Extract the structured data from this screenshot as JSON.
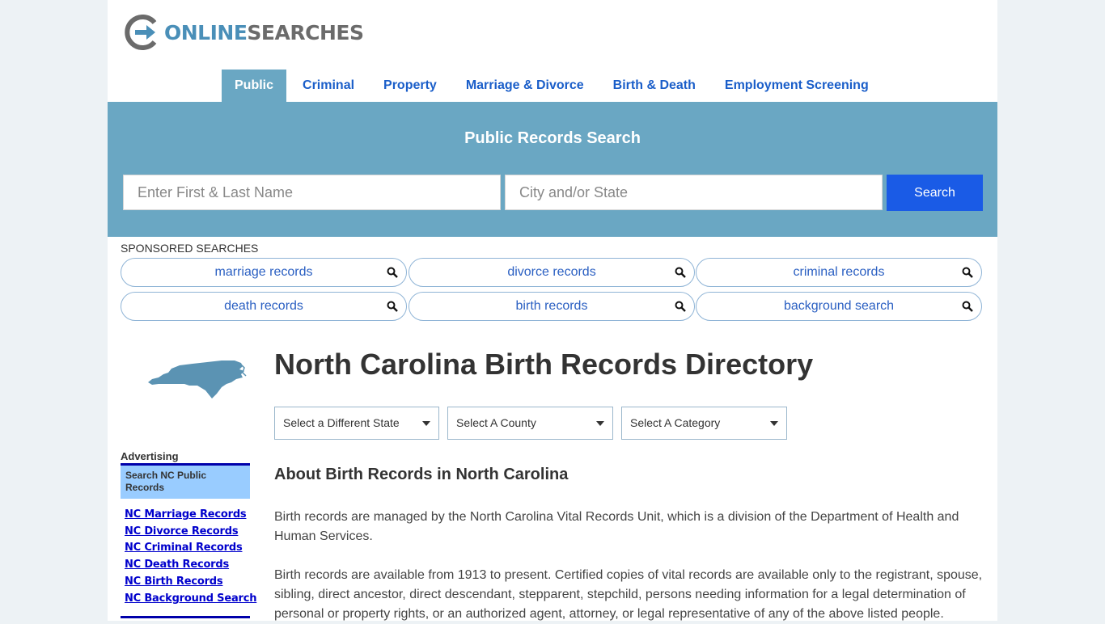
{
  "logo": {
    "part1": "ONLINE",
    "part2": "SEARCHES"
  },
  "nav": [
    "Public",
    "Criminal",
    "Property",
    "Marriage & Divorce",
    "Birth & Death",
    "Employment Screening"
  ],
  "search": {
    "title": "Public Records Search",
    "name_placeholder": "Enter First & Last Name",
    "city_placeholder": "City and/or State",
    "button": "Search"
  },
  "sponsored": {
    "title": "SPONSORED SEARCHES",
    "items": [
      "marriage records",
      "divorce records",
      "criminal records",
      "death records",
      "birth records",
      "background search"
    ]
  },
  "sidebar": {
    "advertising": "Advertising",
    "box_title": "Search NC Public Records",
    "links": [
      "NC Marriage Records",
      "NC Divorce Records",
      "NC Criminal Records",
      "NC Death Records",
      "NC Birth Records",
      "NC Background Search"
    ]
  },
  "main": {
    "title": "North Carolina Birth Records Directory",
    "selects": [
      "Select a Different State",
      "Select A County",
      "Select A Category"
    ],
    "section_title": "About Birth Records in North Carolina",
    "para1": "Birth records are managed by the North Carolina Vital Records Unit, which is a division of the Department of Health and Human Services.",
    "para2": "Birth records are available from 1913 to present. Certified copies of vital records are available only to the registrant, spouse, sibling, direct ancestor, direct descendant, stepparent, stepchild, persons needing information for a legal determination of personal or property rights, or an authorized agent, attorney, or legal representative of any of the above listed people."
  },
  "colors": {
    "band": "#6aa7c3",
    "accent": "#1a5be6",
    "nav_link": "#1a5ec9",
    "map": "#5b93b3"
  }
}
